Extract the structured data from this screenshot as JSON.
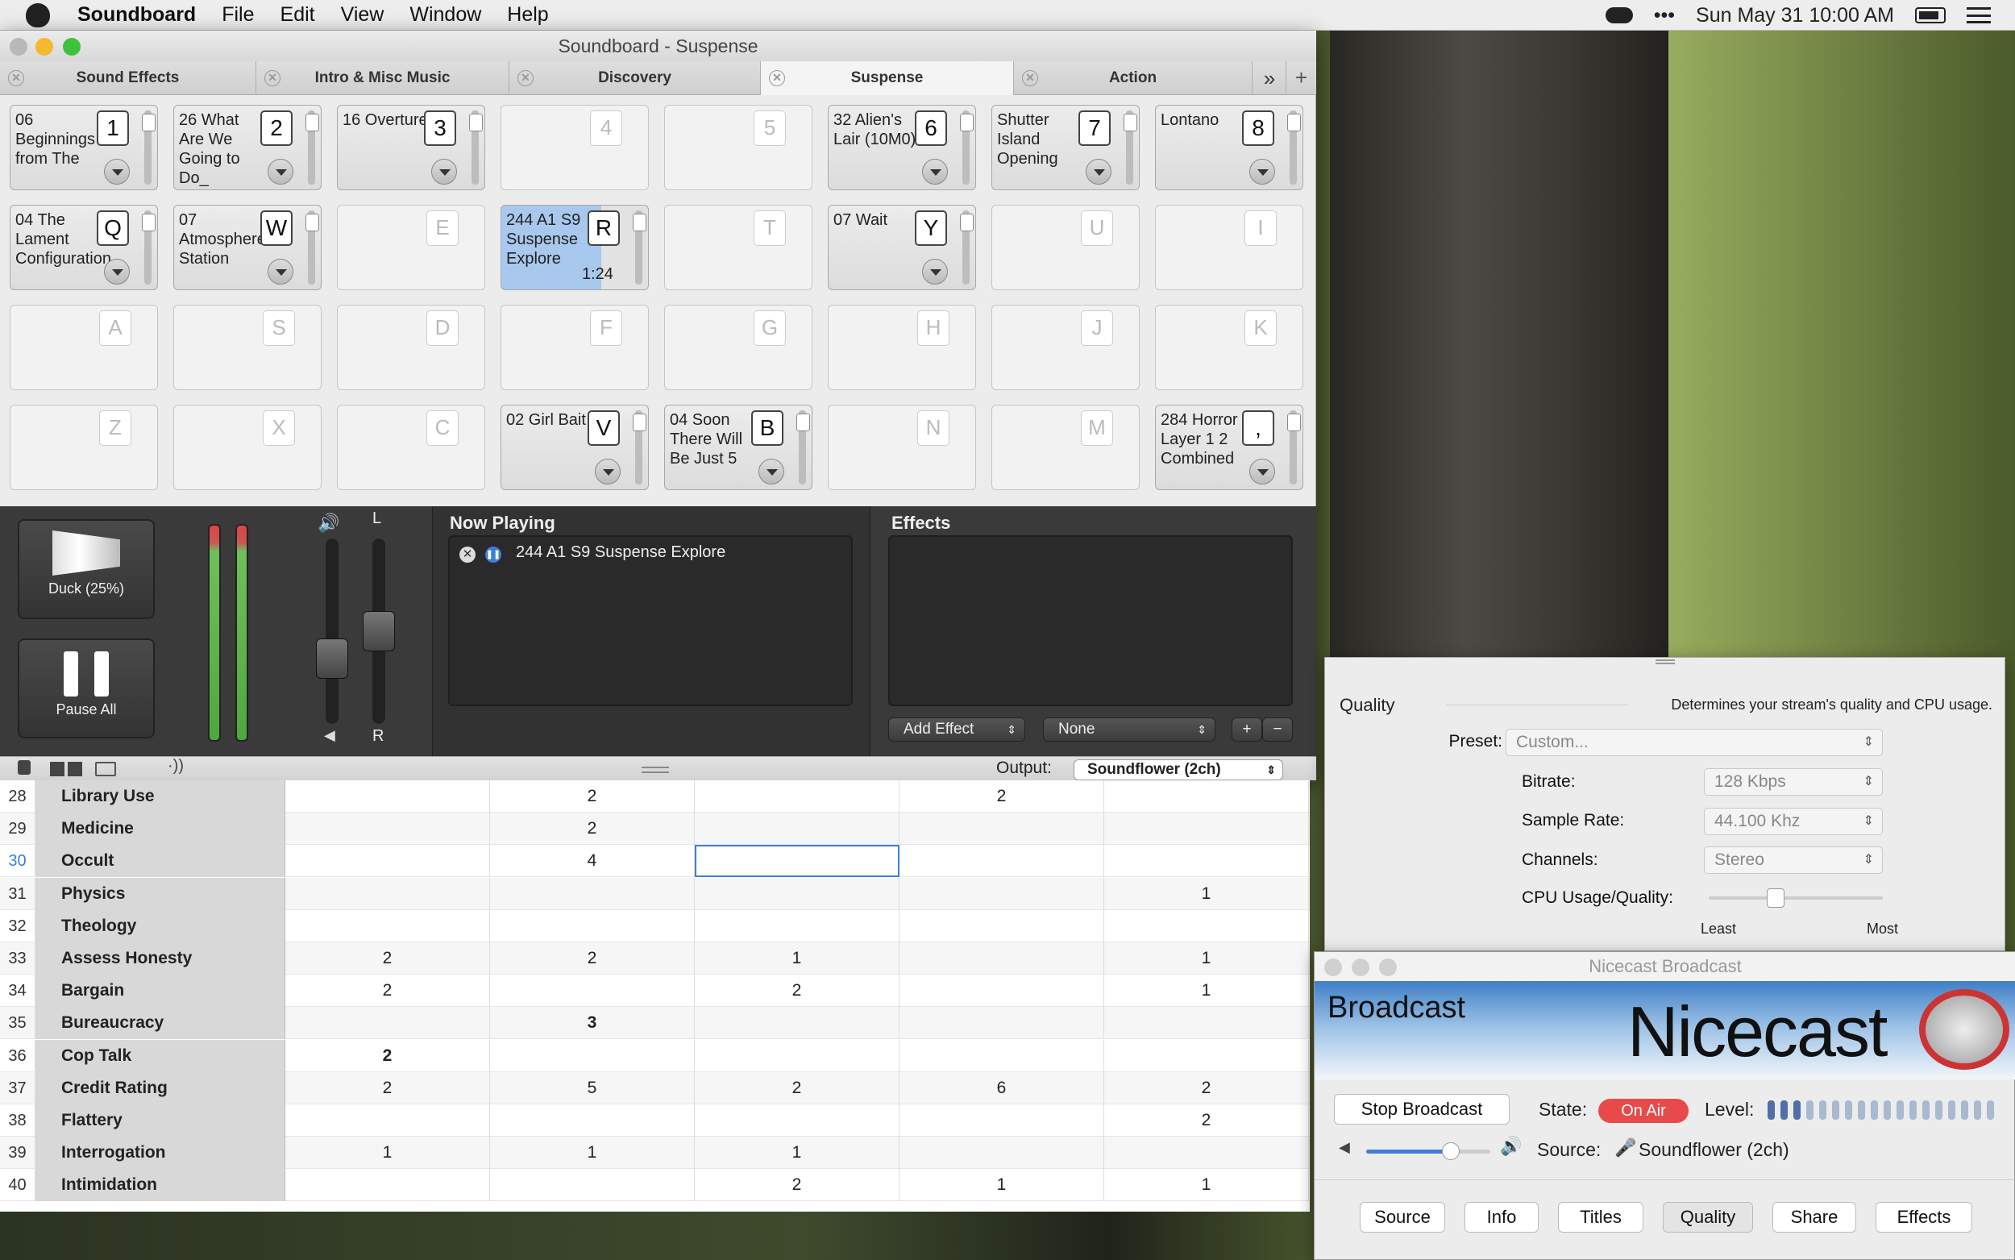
{
  "menubar": {
    "app": "Soundboard",
    "items": [
      "File",
      "Edit",
      "View",
      "Window",
      "Help"
    ],
    "clock": "Sun May 31  10:00 AM"
  },
  "window": {
    "title": "Soundboard - Suspense"
  },
  "tabs": [
    {
      "label": "Sound Effects"
    },
    {
      "label": "Intro & Misc Music"
    },
    {
      "label": "Discovery"
    },
    {
      "label": "Suspense"
    },
    {
      "label": "Action"
    }
  ],
  "tabs_more": "»",
  "tabs_add": "+",
  "cells": [
    [
      {
        "name": "06 Beginnings from The",
        "key": "1"
      },
      {
        "name": "26 What Are We Going to Do_",
        "key": "2"
      },
      {
        "name": "16 Overture",
        "key": "3"
      },
      {
        "name": "",
        "key": "4"
      },
      {
        "name": "",
        "key": "5"
      },
      {
        "name": "32 Alien's Lair (10M0)",
        "key": "6"
      },
      {
        "name": "Shutter Island Opening",
        "key": "7"
      },
      {
        "name": "Lontano",
        "key": "8"
      }
    ],
    [
      {
        "name": "04 The Lament Configuration",
        "key": "Q"
      },
      {
        "name": "07 Atmosphere Station",
        "key": "W"
      },
      {
        "name": "",
        "key": "E"
      },
      {
        "name": "244 A1 S9 Suspense Explore",
        "key": "R",
        "time": "1:24"
      },
      {
        "name": "",
        "key": "T"
      },
      {
        "name": "07 Wait",
        "key": "Y"
      },
      {
        "name": "",
        "key": "U"
      },
      {
        "name": "",
        "key": "I"
      }
    ],
    [
      {
        "name": "",
        "key": "A"
      },
      {
        "name": "",
        "key": "S"
      },
      {
        "name": "",
        "key": "D"
      },
      {
        "name": "",
        "key": "F"
      },
      {
        "name": "",
        "key": "G"
      },
      {
        "name": "",
        "key": "H"
      },
      {
        "name": "",
        "key": "J"
      },
      {
        "name": "",
        "key": "K"
      }
    ],
    [
      {
        "name": "",
        "key": "Z"
      },
      {
        "name": "",
        "key": "X"
      },
      {
        "name": "",
        "key": "C"
      },
      {
        "name": "02 Girl Bait",
        "key": "V"
      },
      {
        "name": "04 Soon There Will Be Just 5",
        "key": "B"
      },
      {
        "name": "",
        "key": "N"
      },
      {
        "name": "",
        "key": "M"
      },
      {
        "name": "284 Horror Layer 1 2 Combined",
        "key": ","
      }
    ]
  ],
  "controls": {
    "duck": "Duck (25%)",
    "pause": "Pause All",
    "pan_l": "L",
    "pan_r": "R"
  },
  "now_playing": {
    "heading": "Now Playing",
    "item": "244 A1 S9 Suspense Explore"
  },
  "effects": {
    "heading": "Effects",
    "add": "Add Effect",
    "preset": "None",
    "plus": "+",
    "minus": "−"
  },
  "status": {
    "output_label": "Output:",
    "output_value": "Soundflower (2ch)"
  },
  "sheet": {
    "rows": [
      {
        "n": "28",
        "label": "Library Use",
        "c": [
          "",
          "2",
          "",
          "2",
          ""
        ]
      },
      {
        "n": "29",
        "label": "Medicine",
        "c": [
          "",
          "2",
          "",
          "",
          ""
        ]
      },
      {
        "n": "30",
        "label": "Occult",
        "c": [
          "",
          "4",
          "",
          "",
          ""
        ]
      },
      {
        "n": "31",
        "label": "Physics",
        "c": [
          "",
          "",
          "",
          "",
          "1"
        ]
      },
      {
        "n": "32",
        "label": "Theology",
        "c": [
          "",
          "",
          "",
          "",
          ""
        ]
      },
      {
        "n": "33",
        "label": "Assess Honesty",
        "c": [
          "2",
          "2",
          "1",
          "",
          "1"
        ]
      },
      {
        "n": "34",
        "label": "Bargain",
        "c": [
          "2",
          "",
          "2",
          "",
          "1"
        ]
      },
      {
        "n": "35",
        "label": "Bureaucracy",
        "c": [
          "",
          "3",
          "",
          "",
          ""
        ]
      },
      {
        "n": "36",
        "label": "Cop Talk",
        "c": [
          "2",
          "",
          "",
          "",
          ""
        ]
      },
      {
        "n": "37",
        "label": "Credit Rating",
        "c": [
          "2",
          "5",
          "2",
          "6",
          "2"
        ]
      },
      {
        "n": "38",
        "label": "Flattery",
        "c": [
          "",
          "",
          "",
          "",
          "2"
        ]
      },
      {
        "n": "39",
        "label": "Interrogation",
        "c": [
          "1",
          "1",
          "1",
          "",
          ""
        ]
      },
      {
        "n": "40",
        "label": "Intimidation",
        "c": [
          "",
          "",
          "2",
          "1",
          "1"
        ]
      }
    ]
  },
  "quality": {
    "heading": "Quality",
    "desc": "Determines your stream's quality and CPU usage.",
    "preset_label": "Preset:",
    "preset": "Custom...",
    "bitrate_label": "Bitrate:",
    "bitrate": "128 Kbps",
    "samplerate_label": "Sample Rate:",
    "samplerate": "44.100 Khz",
    "channels_label": "Channels:",
    "channels": "Stereo",
    "cpu_label": "CPU Usage/Quality:",
    "least": "Least",
    "most": "Most"
  },
  "nicecast": {
    "title": "Nicecast Broadcast",
    "banner": "Broadcast",
    "logo": "Nicecast",
    "stop": "Stop Broadcast",
    "state_label": "State:",
    "state": "On Air",
    "level_label": "Level:",
    "source_label": "Source:",
    "source": "Soundflower (2ch)",
    "buttons": [
      "Source",
      "Info",
      "Titles",
      "Quality",
      "Share",
      "Effects"
    ]
  },
  "colors": {
    "on_air": "#e84a4a",
    "accent": "#3d7fd6"
  }
}
